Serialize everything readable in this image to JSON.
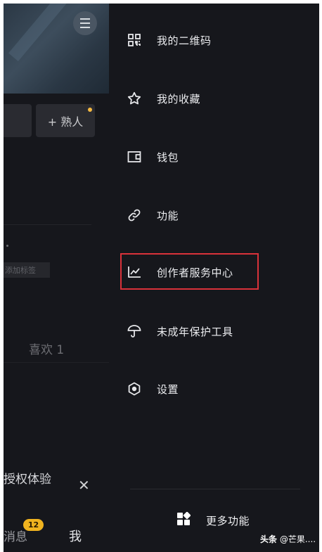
{
  "profile": {
    "acquaintance_button": "+ 熟人",
    "tag_text": "添加标签",
    "likes_tab": "喜欢 1",
    "trial_text": "授权体验",
    "close_glyph": "✕",
    "messages_label": "消息",
    "messages_badge": "12",
    "me_tab": "我"
  },
  "drawer": {
    "items": [
      {
        "label": "我的二维码",
        "icon": "qr-code-icon"
      },
      {
        "label": "我的收藏",
        "icon": "star-icon"
      },
      {
        "label": "钱包",
        "icon": "wallet-icon"
      },
      {
        "label": "功能",
        "icon": "link-icon"
      },
      {
        "label": "创作者服务中心",
        "icon": "trend-chart-icon",
        "highlighted": true
      },
      {
        "label": "未成年保护工具",
        "icon": "umbrella-icon"
      },
      {
        "label": "设置",
        "icon": "settings-icon"
      }
    ],
    "more_label": "更多功能",
    "highlight_color": "#d9323a"
  },
  "watermark": {
    "brand": "头条",
    "text": "@芒果...."
  }
}
